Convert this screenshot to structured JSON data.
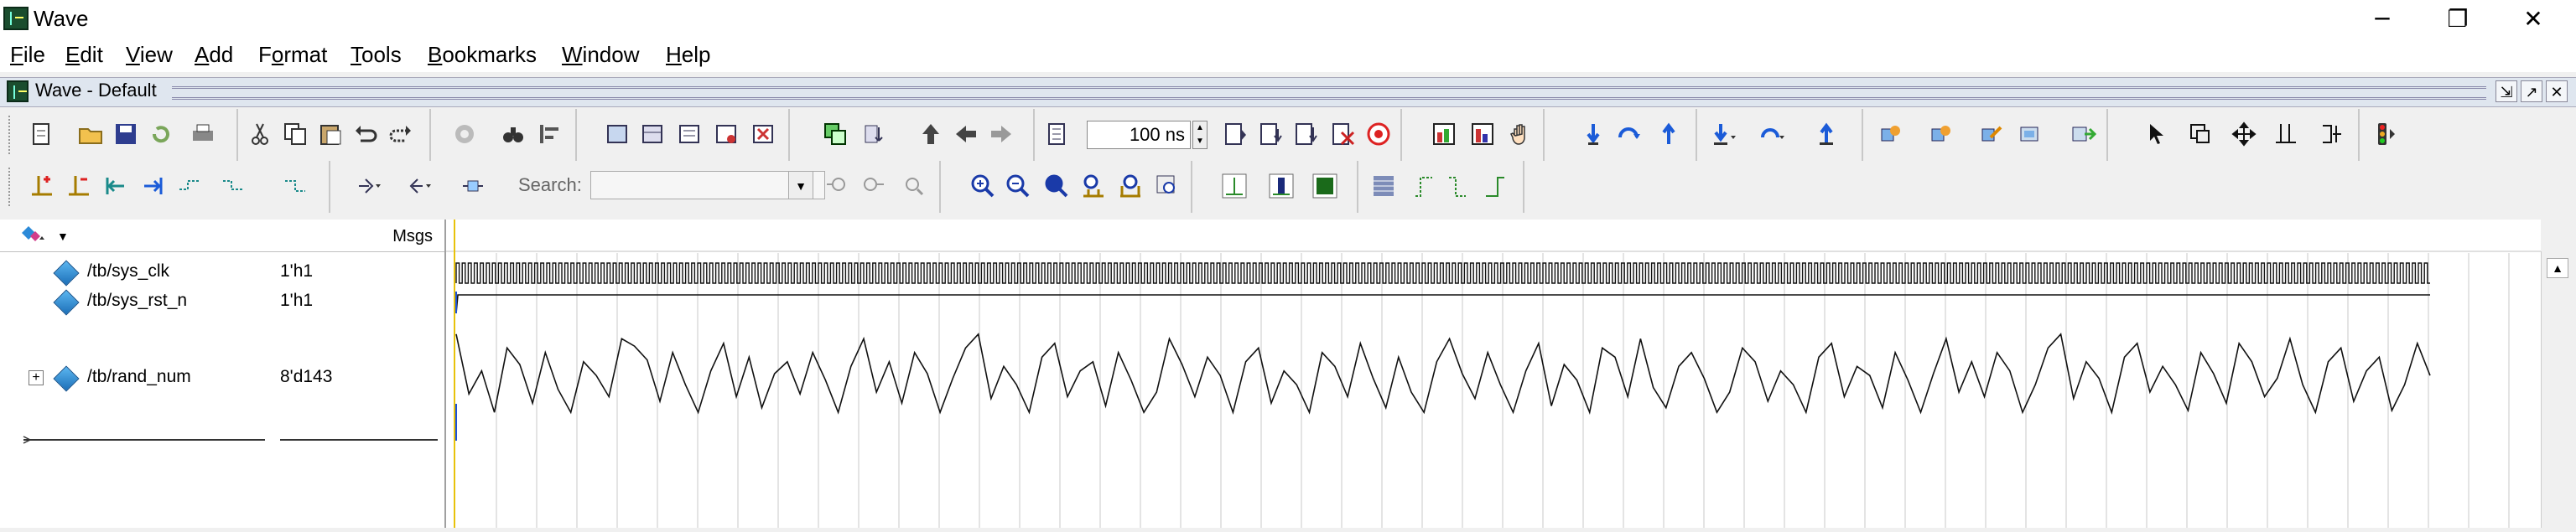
{
  "window": {
    "title": "Wave",
    "minimize": "─",
    "maximize": "❐",
    "close": "✕"
  },
  "menu": [
    {
      "label": "File",
      "key": "F",
      "rest": "ile"
    },
    {
      "label": "Edit",
      "key": "E",
      "rest": "dit"
    },
    {
      "label": "View",
      "key": "V",
      "rest": "iew"
    },
    {
      "label": "Add",
      "key": "A",
      "rest": "dd"
    },
    {
      "label": "Format",
      "key": "o",
      "pre": "F",
      "rest": "rmat"
    },
    {
      "label": "Tools",
      "key": "T",
      "rest": "ools"
    },
    {
      "label": "Bookmarks",
      "key": "B",
      "rest": "ookmarks"
    },
    {
      "label": "Window",
      "key": "W",
      "rest": "indow"
    },
    {
      "label": "Help",
      "key": "H",
      "rest": "elp"
    }
  ],
  "subwindow": {
    "title": "Wave - Default"
  },
  "toolbar": {
    "time_value": "100 ns",
    "search_label": "Search:",
    "search_placeholder": ""
  },
  "signals_header": {
    "msgs": "Msgs"
  },
  "signals": [
    {
      "name": "/tb/sys_clk",
      "value": "1'h1",
      "expandable": false
    },
    {
      "name": "/tb/sys_rst_n",
      "value": "1'h1",
      "expandable": false
    },
    {
      "name": "/tb/rand_num",
      "value": "8'd143",
      "expandable": true
    }
  ],
  "rand_num_wave": [
    228,
    98,
    148,
    58,
    198,
    162,
    78,
    188,
    108,
    58,
    168,
    138,
    92,
    218,
    202,
    172,
    82,
    188,
    118,
    58,
    148,
    208,
    92,
    178,
    68,
    142,
    168,
    98,
    188,
    128,
    58,
    158,
    218,
    102,
    168,
    78,
    188,
    142,
    58,
    132,
    198,
    228,
    88,
    158,
    118,
    58,
    178,
    208,
    92,
    148,
    168,
    72,
    188,
    128,
    58,
    102,
    218,
    162,
    92,
    178,
    138,
    58,
    168,
    198,
    78,
    148,
    118,
    58,
    188,
    158,
    92,
    208,
    132,
    68,
    178,
    102,
    58,
    168,
    218,
    142,
    88,
    188,
    118,
    58,
    148,
    208,
    72,
    162,
    128,
    58,
    198,
    178,
    92,
    218,
    112,
    68,
    158,
    188,
    132,
    58,
    102,
    198,
    168,
    82,
    148,
    118,
    58,
    178,
    208,
    92,
    158,
    138,
    68,
    188,
    128,
    58,
    142,
    218,
    102,
    168,
    92,
    188,
    148,
    58,
    118,
    198,
    228,
    88,
    168,
    132,
    58,
    178,
    208,
    102,
    158,
    118,
    62,
    188,
    142,
    78,
    208,
    168,
    92,
    132,
    218,
    118,
    58,
    168,
    198,
    82,
    148,
    178,
    62,
    118,
    208,
    138
  ]
}
